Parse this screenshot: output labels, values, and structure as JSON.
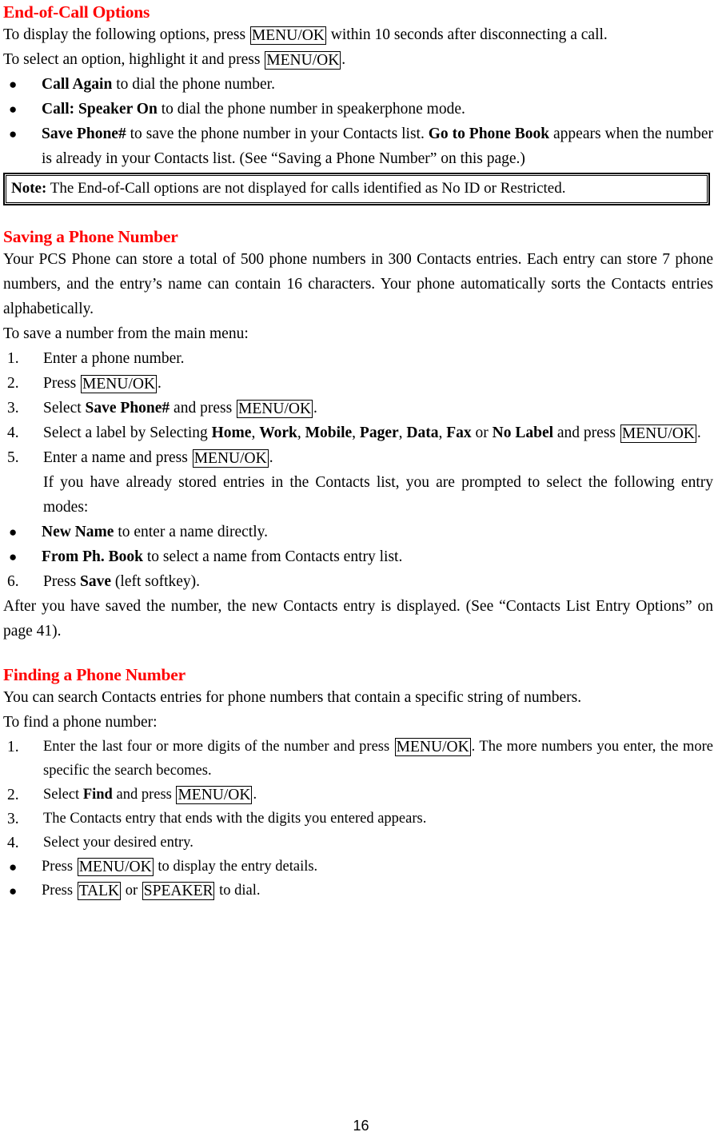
{
  "document": {
    "page_number": "16",
    "accent_color": "#ff0000"
  },
  "sections": {
    "end_of_call": {
      "heading": "End-of-Call Options",
      "intro_line1_a": "To display the following options, press ",
      "intro_line1_key": "MENU/OK",
      "intro_line1_b": " within 10 seconds after disconnecting a call.",
      "intro_line2_a": "To select an option, highlight it and press ",
      "intro_line2_key": "MENU/OK",
      "intro_line2_b": ".",
      "bullets": [
        {
          "marker": "●",
          "bold": "Call Again",
          "rest": " to dial the phone number."
        },
        {
          "marker": "●",
          "bold": "Call: Speaker On",
          "rest": " to dial the phone number in speakerphone mode."
        },
        {
          "marker": "●",
          "bold": "Save Phone#",
          "rest": " to save the phone number in your Contacts list. ",
          "bold2": "Go to Phone Book",
          "rest2": " appears when the number is already in your Contacts list. (See “Saving a Phone Number” on this page.)"
        }
      ],
      "note": {
        "label": "Note:",
        "text": " The End-of-Call options are not displayed for calls identified as No ID or Restricted."
      }
    },
    "saving_phone_number": {
      "heading": "Saving a Phone Number",
      "paragraph": "Your PCS Phone can store a total of 500 phone numbers in 300 Contacts entries. Each entry can store 7 phone numbers, and the entry’s name can contain 16 characters. Your phone automatically sorts the Contacts entries alphabetically.",
      "lead_in": "To save a number from the main menu:",
      "steps": [
        {
          "marker": "1.",
          "text": "Enter a phone number."
        },
        {
          "marker": "2.",
          "pre": "Press ",
          "key": "MENU/OK",
          "post": "."
        },
        {
          "marker": "3.",
          "pre": "Select ",
          "bold": "Save Phone#",
          "mid": " and press ",
          "key": "MENU/OK",
          "post": "."
        },
        {
          "marker": "4.",
          "pre": "Select a label by Selecting ",
          "labels": [
            "Home",
            "Work",
            "Mobile",
            "Pager",
            "Data",
            "Fax"
          ],
          "conj": " or ",
          "last_label": "No Label",
          "mid": " and press ",
          "key": "MENU/OK",
          "post": "."
        },
        {
          "marker": "5.",
          "pre": "Enter a name and press ",
          "key": "MENU/OK",
          "post": ".",
          "continuation": "If you have already stored entries in the Contacts list, you are prompted to select the following entry modes:"
        }
      ],
      "mode_bullets": [
        {
          "marker": "●",
          "bold": "New Name",
          "rest": " to enter a name directly."
        },
        {
          "marker": "●",
          "bold": "From Ph. Book",
          "rest": " to select a name from Contacts entry list."
        }
      ],
      "step6": {
        "marker": "6.",
        "pre": "Press ",
        "bold": "Save",
        "post": " (left softkey)."
      },
      "closing": "After you have saved the number, the new Contacts entry is displayed. (See “Contacts List Entry Options” on page 41)."
    },
    "finding_phone_number": {
      "heading": "Finding a Phone Number",
      "intro": "You can search Contacts entries for phone numbers that contain a specific string of numbers.",
      "lead_in": "To find a phone number:",
      "steps": [
        {
          "marker": "1.",
          "pre": "Enter the last four or more digits of the number and press ",
          "key": "MENU/OK",
          "post": ". The more numbers you enter, the more specific the search becomes."
        },
        {
          "marker": "2.",
          "pre": "Select ",
          "bold": "Find",
          "mid": " and press ",
          "key": "MENU/OK",
          "post": "."
        },
        {
          "marker": "3.",
          "text": "The Contacts entry that ends with the digits you entered appears."
        },
        {
          "marker": "4.",
          "text": "Select your desired entry."
        }
      ],
      "final_bullets": [
        {
          "marker": "●",
          "pre": "Press ",
          "key": "MENU/OK",
          "post": " to display the entry details."
        },
        {
          "marker": "●",
          "pre": "Press ",
          "key": "TALK",
          "mid": " or ",
          "key2": "SPEAKER",
          "post": " to dial."
        }
      ]
    }
  }
}
